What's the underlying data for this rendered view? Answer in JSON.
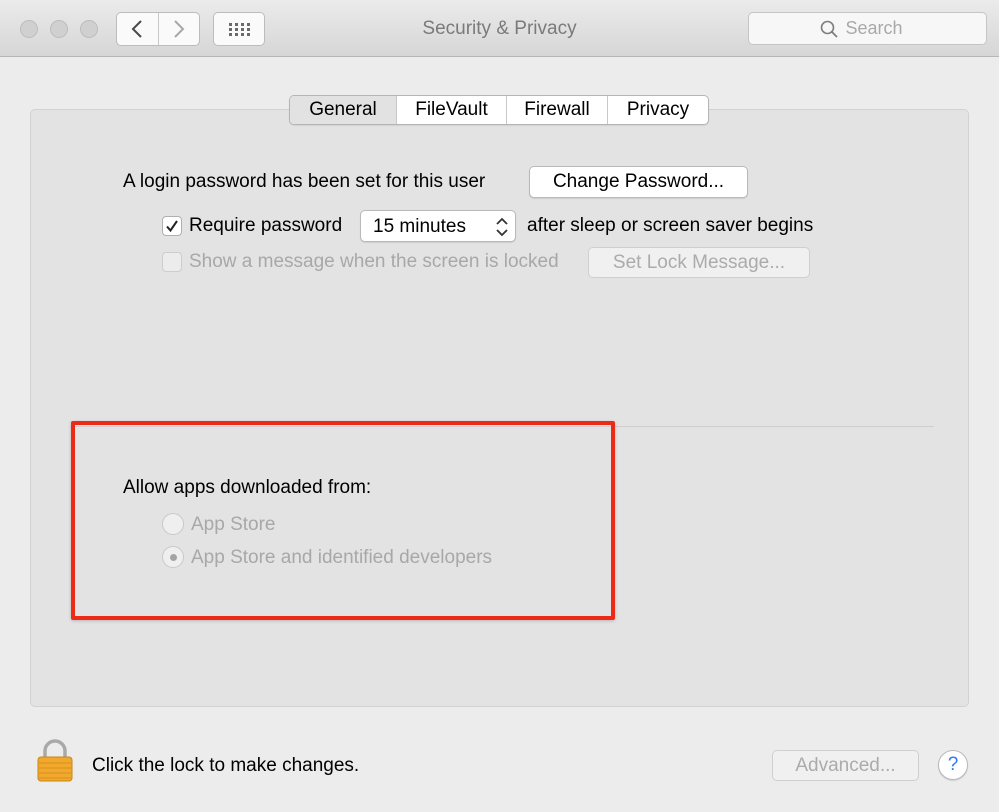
{
  "window": {
    "title": "Security & Privacy"
  },
  "toolbar": {
    "search_placeholder": "Search"
  },
  "tabs": [
    {
      "label": "General",
      "active": true
    },
    {
      "label": "FileVault",
      "active": false
    },
    {
      "label": "Firewall",
      "active": false
    },
    {
      "label": "Privacy",
      "active": false
    }
  ],
  "general": {
    "login_password_text": "A login password has been set for this user",
    "change_password_button": "Change Password...",
    "require_password": {
      "label": "Require password",
      "checked": true,
      "delay_value": "15 minutes",
      "suffix": "after sleep or screen saver begins"
    },
    "show_message": {
      "label": "Show a message when the screen is locked",
      "checked": false,
      "disabled": true,
      "button": "Set Lock Message..."
    },
    "allow_apps": {
      "heading": "Allow apps downloaded from:",
      "options": [
        {
          "label": "App Store",
          "selected": false,
          "disabled": true
        },
        {
          "label": "App Store and identified developers",
          "selected": true,
          "disabled": true
        }
      ]
    }
  },
  "footer": {
    "lock_text": "Click the lock to make changes.",
    "advanced_button": "Advanced...",
    "help_label": "?"
  },
  "colors": {
    "highlight_border": "#ec2a16",
    "help_accent": "#2f7bf5",
    "lock_gold": "#f0a92c"
  },
  "icons": [
    "back-chevron-icon",
    "forward-chevron-icon",
    "grid-icon",
    "search-icon",
    "checkmark-icon",
    "stepper-chevrons-icon",
    "lock-icon",
    "help-icon"
  ]
}
